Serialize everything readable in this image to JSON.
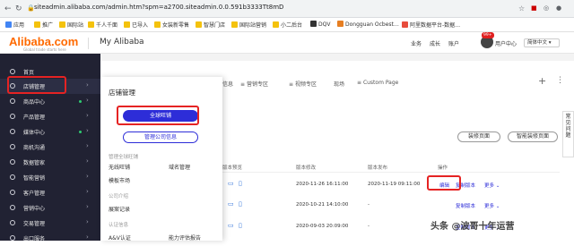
{
  "browser": {
    "url": "siteadmin.alibaba.com/admin.htm?spm=a2700.siteadmin.0.0.591b3333Tt8mD",
    "bookmarks": [
      "应用",
      "推广",
      "国际站",
      "千人千面",
      "已导入",
      "女装新零售",
      "智慧门店",
      "国际站营销",
      "小二后台",
      "DQV",
      "Dongguan Ocbest…",
      "阿里数据平台-数据…"
    ]
  },
  "header": {
    "logo": "Alibaba.com",
    "tagline": "Global trade starts here",
    "title": "My Alibaba",
    "links": [
      "业务",
      "成长",
      "账户"
    ],
    "badge": "99+",
    "user_center": "用户中心",
    "language": "简体中文"
  },
  "sidebar": {
    "items": [
      {
        "label": "首页",
        "dot": false
      },
      {
        "label": "店铺管理",
        "dot": false
      },
      {
        "label": "商品中心",
        "dot": true
      },
      {
        "label": "产品管理",
        "dot": false
      },
      {
        "label": "媒体中心",
        "dot": true
      },
      {
        "label": "商机沟通",
        "dot": false
      },
      {
        "label": "数据管家",
        "dot": false
      },
      {
        "label": "智能营销",
        "dot": false
      },
      {
        "label": "客户管理",
        "dot": false
      },
      {
        "label": "营销中心",
        "dot": false
      },
      {
        "label": "交易管理",
        "dot": false
      },
      {
        "label": "出口服务",
        "dot": false
      }
    ]
  },
  "flyout": {
    "title": "店铺管理",
    "primary_button": "全球旺铺",
    "secondary_button": "管理公司信息",
    "section1": "管理全球旺铺",
    "items1": [
      "无线旺铺",
      "域名管理",
      "模板市场"
    ],
    "section2": "公司介绍",
    "items2": [
      "展案记录"
    ],
    "section3": "认证信息",
    "items3": [
      "A&V认证",
      "能力评估报告"
    ]
  },
  "main": {
    "tabs": [
      "信息",
      "营销专区",
      "视频专区",
      "现场",
      "Custom Page"
    ],
    "btn_decorate": "装修页面",
    "btn_smart": "智能装修页面",
    "columns": [
      "版本预览",
      "版本修改",
      "版本发布",
      "操作"
    ],
    "rows": [
      {
        "modified": "2020-11-26 16:11:00",
        "published": "2020-11-19 09:11:00",
        "actions": [
          "编辑",
          "复制版本",
          "更多"
        ]
      },
      {
        "modified": "2020-10-21 14:10:00",
        "published": "-",
        "actions": [
          "复制版本",
          "更多"
        ]
      },
      {
        "modified": "2020-09-03 20:09:00",
        "published": "-",
        "actions": [
          "复制版本",
          "更多"
        ]
      }
    ]
  },
  "help": "常见问题",
  "watermark": "头条 @波哥十年运营"
}
